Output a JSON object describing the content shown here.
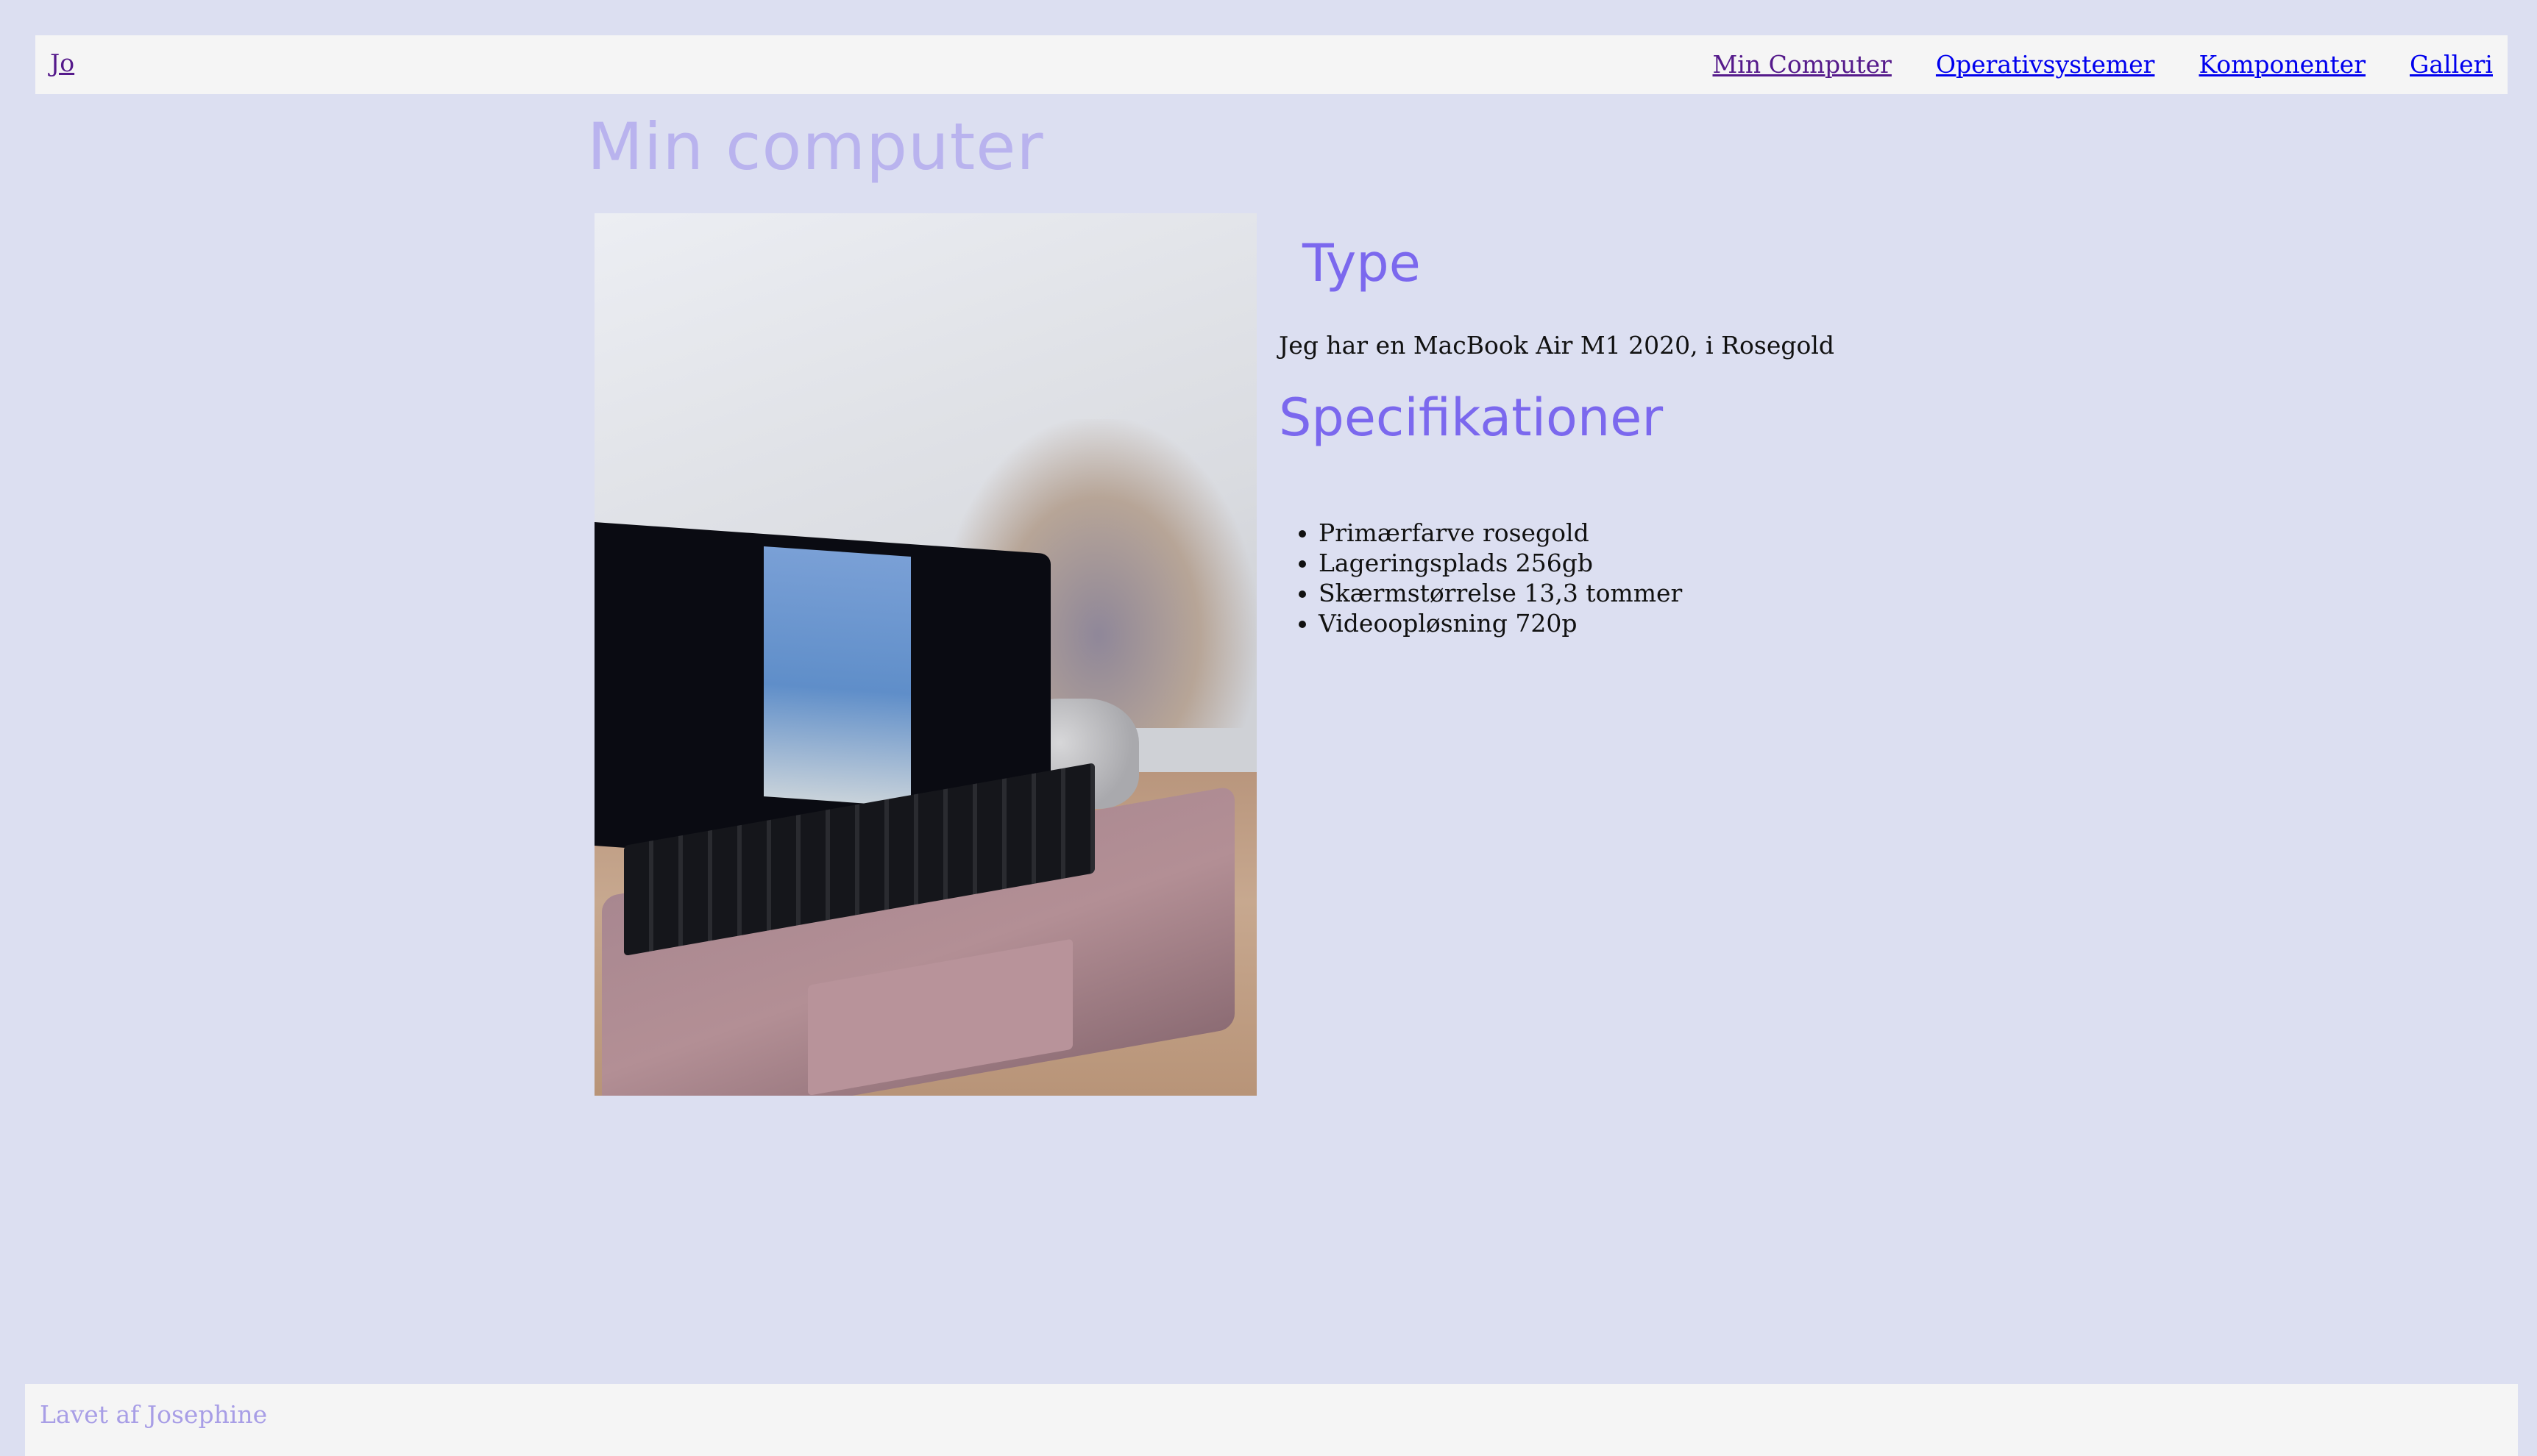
{
  "nav": {
    "brand": "Jo",
    "links": [
      {
        "label": "Min Computer"
      },
      {
        "label": "Operativsystemer"
      },
      {
        "label": "Komponenter"
      },
      {
        "label": "Galleri"
      }
    ]
  },
  "page": {
    "title": "Min computer"
  },
  "type_section": {
    "heading": "Type",
    "text": "Jeg har en MacBook Air M1 2020, i Rosegold"
  },
  "spec_section": {
    "heading": "Specifikationer",
    "items": [
      "Primærfarve rosegold",
      "Lageringsplads 256gb",
      "Skærmstørrelse 13,3 tommer",
      "Videoopløsning 720p"
    ]
  },
  "footer": {
    "text": "Lavet af Josephine"
  },
  "colors": {
    "background": "#dcdff1",
    "heading_accent": "#7b68ee",
    "title_muted": "#b9b3ee",
    "bar_background": "#f5f5f5",
    "link": "#0000ee",
    "visited_link": "#551a8b"
  }
}
